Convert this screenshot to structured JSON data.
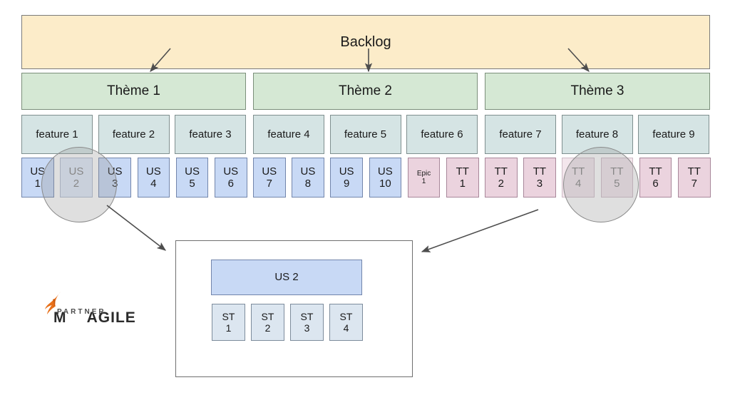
{
  "backlog": {
    "label": "Backlog"
  },
  "themes": [
    {
      "label": "Thème 1"
    },
    {
      "label": "Thème 2"
    },
    {
      "label": "Thème 3"
    }
  ],
  "features": [
    {
      "label": "feature 1"
    },
    {
      "label": "feature 2"
    },
    {
      "label": "feature 3"
    },
    {
      "label": "feature 4"
    },
    {
      "label": "feature 5"
    },
    {
      "label": "feature 6"
    },
    {
      "label": "feature 7"
    },
    {
      "label": "feature 8"
    },
    {
      "label": "feature 9"
    }
  ],
  "cards": [
    {
      "line1": "US",
      "line2": "1",
      "kind": "us",
      "dimmed": false,
      "small": false
    },
    {
      "line1": "US",
      "line2": "2",
      "kind": "us",
      "dimmed": true,
      "small": false
    },
    {
      "line1": "US",
      "line2": "3",
      "kind": "us",
      "dimmed": false,
      "small": false
    },
    {
      "line1": "US",
      "line2": "4",
      "kind": "us",
      "dimmed": false,
      "small": false
    },
    {
      "line1": "US",
      "line2": "5",
      "kind": "us",
      "dimmed": false,
      "small": false
    },
    {
      "line1": "US",
      "line2": "6",
      "kind": "us",
      "dimmed": false,
      "small": false
    },
    {
      "line1": "US",
      "line2": "7",
      "kind": "us",
      "dimmed": false,
      "small": false
    },
    {
      "line1": "US",
      "line2": "8",
      "kind": "us",
      "dimmed": false,
      "small": false
    },
    {
      "line1": "US",
      "line2": "9",
      "kind": "us",
      "dimmed": false,
      "small": false
    },
    {
      "line1": "US",
      "line2": "10",
      "kind": "us",
      "dimmed": false,
      "small": false
    },
    {
      "line1": "Epic",
      "line2": "1",
      "kind": "epic",
      "dimmed": false,
      "small": true
    },
    {
      "line1": "TT",
      "line2": "1",
      "kind": "tt",
      "dimmed": false,
      "small": false
    },
    {
      "line1": "TT",
      "line2": "2",
      "kind": "tt",
      "dimmed": false,
      "small": false
    },
    {
      "line1": "TT",
      "line2": "3",
      "kind": "tt",
      "dimmed": false,
      "small": false
    },
    {
      "line1": "TT",
      "line2": "4",
      "kind": "tt",
      "dimmed": true,
      "small": false
    },
    {
      "line1": "TT",
      "line2": "5",
      "kind": "tt",
      "dimmed": true,
      "small": false
    },
    {
      "line1": "TT",
      "line2": "6",
      "kind": "tt",
      "dimmed": false,
      "small": false
    },
    {
      "line1": "TT",
      "line2": "7",
      "kind": "tt",
      "dimmed": false,
      "small": false
    }
  ],
  "detail": {
    "story_label": "US 2",
    "tasks": [
      {
        "line1": "ST",
        "line2": "1"
      },
      {
        "line1": "ST",
        "line2": "2"
      },
      {
        "line1": "ST",
        "line2": "3"
      },
      {
        "line1": "ST",
        "line2": "4"
      }
    ]
  },
  "logo": {
    "text_left": "M",
    "text_right": "AGILE",
    "subtitle": "PARTNER"
  },
  "colors": {
    "backlog_fill": "#FCECC9",
    "theme_fill": "#D5E8D4",
    "feature_fill": "#D5E4E4",
    "us_fill": "#C8D9F5",
    "tt_fill": "#EBD3DE",
    "st_fill": "#DCE6F0",
    "stroke": "#808080",
    "arrow": "#4D4D4D",
    "logo_accent": "#E8701A",
    "magnifier_fill": "rgba(150,150,150,0.30)"
  }
}
